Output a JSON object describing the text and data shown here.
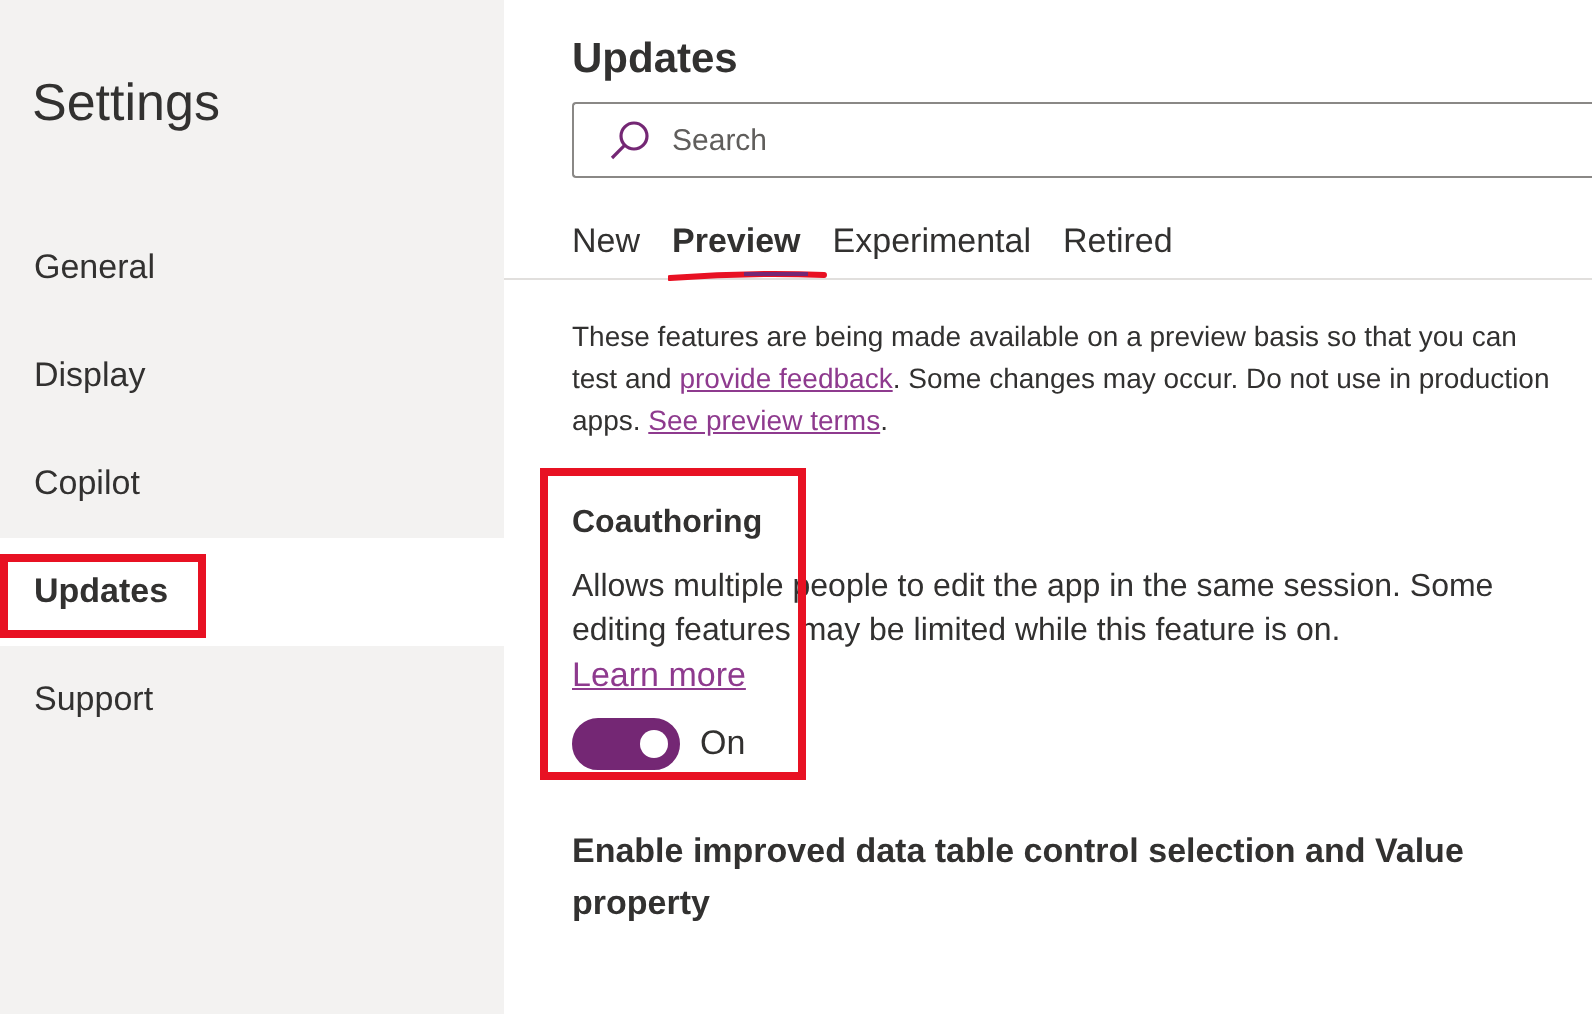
{
  "sidebar": {
    "title": "Settings",
    "items": [
      {
        "label": "General",
        "selected": false,
        "highlighted": false
      },
      {
        "label": "Display",
        "selected": false,
        "highlighted": false
      },
      {
        "label": "Copilot",
        "selected": false,
        "highlighted": false
      },
      {
        "label": "Updates",
        "selected": true,
        "highlighted": true
      },
      {
        "label": "Support",
        "selected": false,
        "highlighted": false
      }
    ]
  },
  "main": {
    "title": "Updates",
    "search": {
      "placeholder": "Search"
    },
    "tabs": [
      {
        "label": "New",
        "selected": false,
        "highlighted": false
      },
      {
        "label": "Preview",
        "selected": true,
        "highlighted": true
      },
      {
        "label": "Experimental",
        "selected": false,
        "highlighted": false
      },
      {
        "label": "Retired",
        "selected": false,
        "highlighted": false
      }
    ],
    "intro": [
      {
        "kind": "text",
        "text": "These features are being made available on a preview basis so that you can test and "
      },
      {
        "kind": "link",
        "text": "provide feedback"
      },
      {
        "kind": "text",
        "text": ". Some changes may occur. Do not use in production apps. "
      },
      {
        "kind": "link",
        "text": "See preview terms"
      },
      {
        "kind": "text",
        "text": "."
      }
    ],
    "features": [
      {
        "title": "Coauthoring",
        "description": "Allows multiple people to edit the app in the same session. Some editing features may be limited while this feature is on.",
        "link": "Learn more",
        "on": true,
        "state_label": "On",
        "highlighted": true
      },
      {
        "title": "Enable improved data table control selection and Value property",
        "highlighted": false
      }
    ]
  }
}
